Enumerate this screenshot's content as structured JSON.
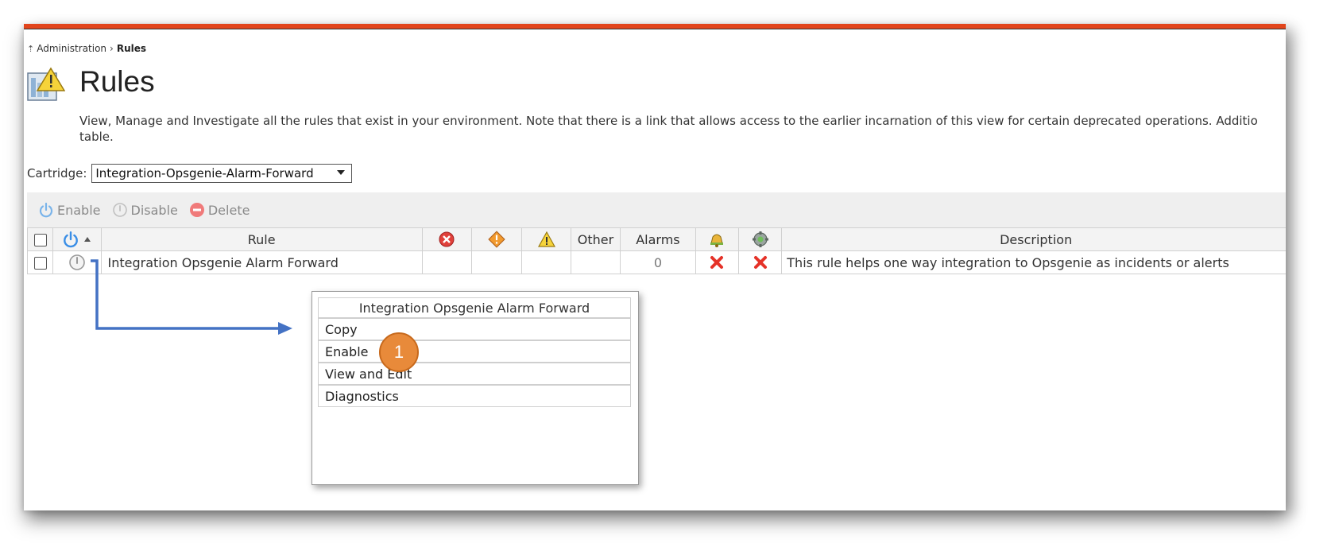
{
  "breadcrumb": {
    "parent": "Administration",
    "separator": "›",
    "current": "Rules"
  },
  "page": {
    "title": "Rules",
    "description_line1": "View, Manage and Investigate all the rules that exist in your environment. Note that there is a link that allows access to the earlier incarnation of this view for certain deprecated operations. Additio",
    "description_line2": "table."
  },
  "cartridge": {
    "label": "Cartridge:",
    "value": "Integration-Opsgenie-Alarm-Forward"
  },
  "toolbar": {
    "enable": "Enable",
    "disable": "Disable",
    "delete": "Delete"
  },
  "table": {
    "headers": {
      "rule": "Rule",
      "other": "Other",
      "alarms": "Alarms",
      "description": "Description"
    },
    "rows": [
      {
        "rule": "Integration Opsgenie Alarm Forward",
        "alarms": "0",
        "description": "This rule helps one way integration to Opsgenie as incidents or alerts"
      }
    ]
  },
  "context_menu": {
    "title": "Integration Opsgenie Alarm Forward",
    "items": [
      "Copy",
      "Enable",
      "View and Edit",
      "Diagnostics"
    ]
  },
  "callout": {
    "number": "1"
  },
  "colors": {
    "accent": "#e2451c",
    "power_blue": "#3a8ee6",
    "arrow_blue": "#4472c4",
    "callout": "#e88a3a"
  }
}
